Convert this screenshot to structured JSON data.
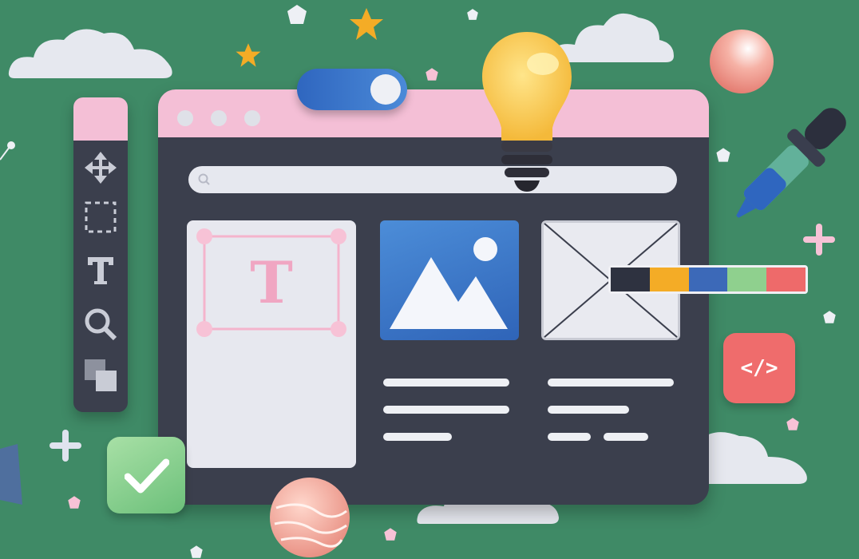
{
  "illustration": {
    "text_glyph": "T",
    "code_badge_text": "</>",
    "palette_colors": [
      "#2e3240",
      "#f4ac26",
      "#3c69b8",
      "#8fd08e",
      "#ee6a6a"
    ],
    "window_dots": 3,
    "icons": [
      "move-icon",
      "marquee-select-icon",
      "text-tool-icon",
      "zoom-icon",
      "layers-icon",
      "search-icon",
      "lightbulb-icon",
      "eyedropper-icon",
      "check-icon",
      "code-icon",
      "image-icon",
      "star-icon",
      "plus-icon",
      "cloud-icon"
    ]
  },
  "colors": {
    "background": "#3f8a66",
    "window": "#3b3f4d",
    "titlebar": "#f4bfd6",
    "accent_blue": "#2f66bf",
    "accent_pink": "#f7b7cf",
    "code_badge": "#ef6c6c",
    "check_badge": "#7cc887"
  }
}
